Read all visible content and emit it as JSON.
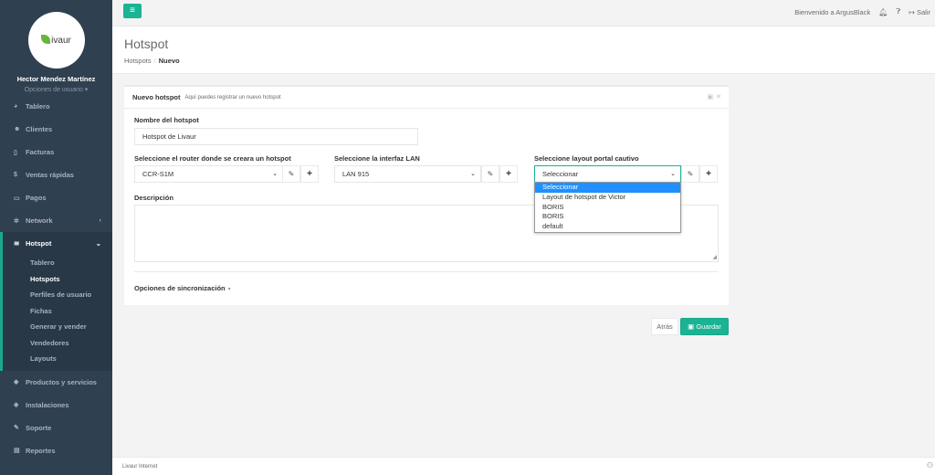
{
  "topbar": {
    "welcome": "Bienvenido a ArgusBlack",
    "logout_label": "Salir"
  },
  "profile": {
    "logo_text": "ivaur",
    "name": "Hector Mendez Martínez",
    "options": "Opciones de usuario ▾"
  },
  "sidebar": {
    "items_top": [
      {
        "label": "Tablero",
        "icon": "dashboard-icon"
      },
      {
        "label": "Clientes",
        "icon": "users-icon"
      },
      {
        "label": "Facturas",
        "icon": "file-icon"
      },
      {
        "label": "Ventas rápidas",
        "icon": "dollar-icon"
      },
      {
        "label": "Pagos",
        "icon": "money-icon"
      },
      {
        "label": "Network",
        "icon": "gear-icon"
      }
    ],
    "active": {
      "label": "Hotspot",
      "icon": "wifi-icon",
      "subitems": [
        "Tablero",
        "Hotspots",
        "Perfiles de usuario",
        "Fichas",
        "Generar y vender",
        "Vendedores",
        "Layouts"
      ]
    },
    "items_bottom": [
      {
        "label": "Productos y servicios",
        "icon": "tag-icon"
      },
      {
        "label": "Instalaciones",
        "icon": "install-icon"
      },
      {
        "label": "Soporte",
        "icon": "wrench-icon"
      },
      {
        "label": "Reportes",
        "icon": "book-icon"
      }
    ]
  },
  "header": {
    "title": "Hotspot",
    "crumb1": "Hotspots",
    "crumb_sep": "/",
    "crumb2": "Nuevo"
  },
  "panel": {
    "title": "Nuevo hotspot",
    "subtitle": "Aquí puedes registrar un nuevo hotspot"
  },
  "form": {
    "name_label": "Nombre del hotspot",
    "name_value": "Hotspot de Livaur",
    "router_label": "Seleccione el router donde se creara un hotspot",
    "router_value": "CCR-S1M",
    "lan_label": "Seleccione la interfaz LAN",
    "lan_value": "LAN 915",
    "layout_label": "Seleccione layout portal cautivo",
    "layout_value": "Seleccionar",
    "layout_options": [
      "Seleccionar",
      "Layout de hotspot de Victor",
      "BORIS",
      "BORIS",
      "default"
    ],
    "desc_label": "Descripción",
    "sync_label": "Opciones de sincronización"
  },
  "actions": {
    "back": "Atrás",
    "save": "Guardar"
  },
  "footer": {
    "text": "Livaur Internet"
  },
  "colors": {
    "sidebar": "#2f4050",
    "accent": "#1ab394",
    "selected_option": "#1e90ff"
  }
}
